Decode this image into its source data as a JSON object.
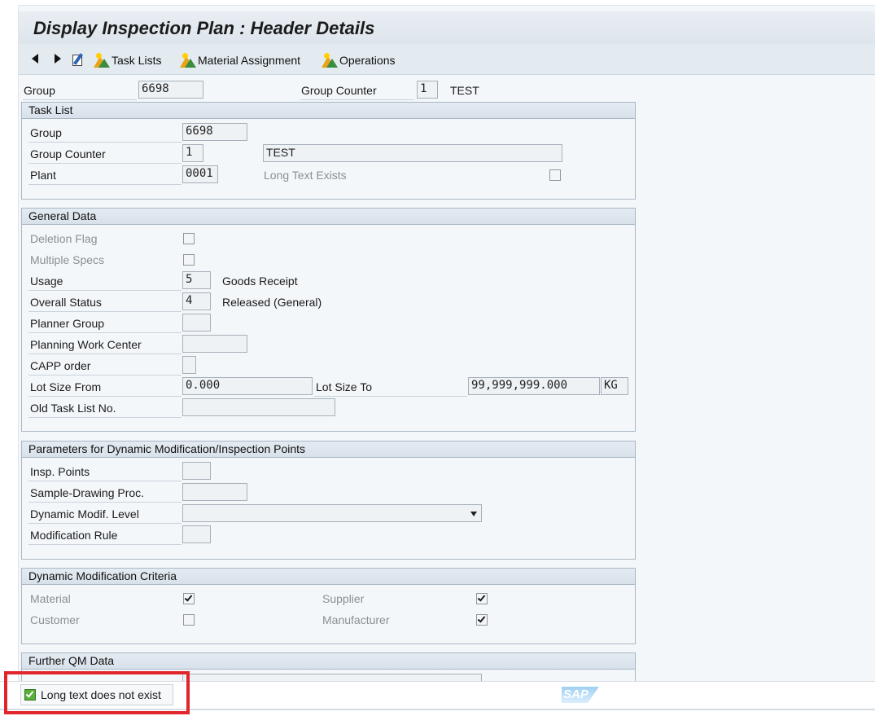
{
  "window": {
    "title": "Display Inspection Plan : Header Details"
  },
  "toolbar": {
    "task_lists": "Task Lists",
    "material_assignment": "Material Assignment",
    "operations": "Operations"
  },
  "header": {
    "group_label": "Group",
    "group_value": "6698",
    "group_counter_label": "Group Counter",
    "group_counter_value": "1",
    "group_counter_text": "TEST"
  },
  "task_list": {
    "title": "Task List",
    "group_label": "Group",
    "group_value": "6698",
    "group_counter_label": "Group Counter",
    "group_counter_value": "1",
    "group_counter_text": "TEST",
    "plant_label": "Plant",
    "plant_value": "0001",
    "long_text_label": "Long Text Exists",
    "long_text_checked": false
  },
  "general_data": {
    "title": "General Data",
    "deletion_flag_label": "Deletion Flag",
    "multiple_specs_label": "Multiple Specs",
    "usage_label": "Usage",
    "usage_value": "5",
    "usage_text": "Goods Receipt",
    "overall_status_label": "Overall Status",
    "overall_status_value": "4",
    "overall_status_text": "Released (General)",
    "planner_group_label": "Planner Group",
    "planning_work_center_label": "Planning Work Center",
    "capp_order_label": "CAPP order",
    "lot_size_from_label": "Lot Size From",
    "lot_size_from_value": "0.000",
    "lot_size_to_label": "Lot Size To",
    "lot_size_to_value": "99,999,999.000",
    "lot_size_unit": "KG",
    "old_task_list_label": "Old Task List No."
  },
  "dyn_params": {
    "title": "Parameters for Dynamic Modification/Inspection Points",
    "insp_points_label": "Insp. Points",
    "sample_drawing_label": "Sample-Drawing Proc.",
    "dyn_modif_level_label": "Dynamic Modif. Level",
    "modification_rule_label": "Modification Rule"
  },
  "dyn_criteria": {
    "title": "Dynamic Modification Criteria",
    "material_label": "Material",
    "material_checked": true,
    "customer_label": "Customer",
    "customer_checked": false,
    "supplier_label": "Supplier",
    "supplier_checked": true,
    "manufacturer_label": "Manufacturer",
    "manufacturer_checked": true
  },
  "further_qm": {
    "title": "Further QM Data"
  },
  "status": {
    "message": "Long text does not exist",
    "logo": "SAP"
  }
}
